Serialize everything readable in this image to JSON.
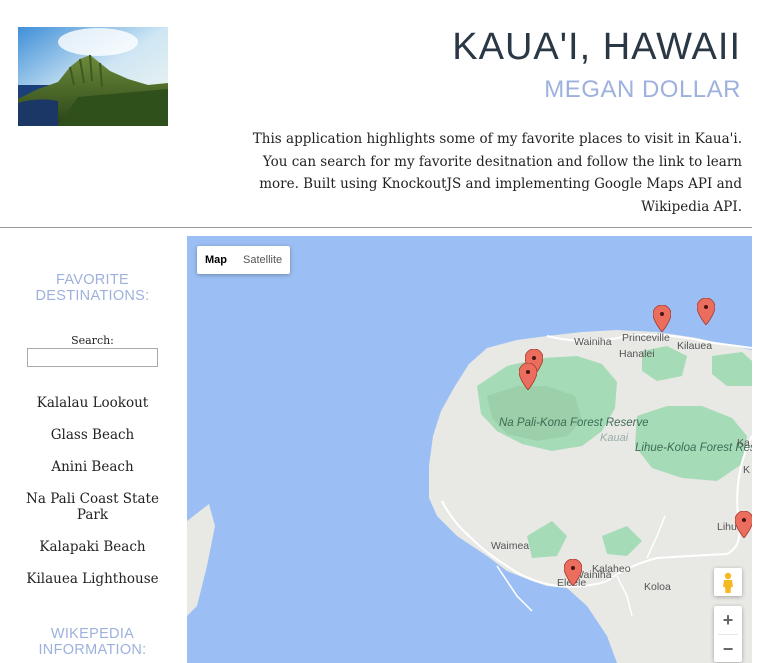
{
  "header": {
    "title": "KAUA'I, HAWAII",
    "subtitle": "MEGAN DOLLAR",
    "description": "This application highlights some of my favorite places to visit in Kaua'i. You can search for my favorite desitnation and follow the link to learn more. Built using KnockoutJS and implementing Google Maps API and Wikipedia API."
  },
  "sidebar": {
    "favorites_heading": "FAVORITE DESTINATIONS:",
    "search_label": "Search:",
    "search_value": "",
    "locations": [
      "Kalalau Lookout",
      "Glass Beach",
      "Anini Beach",
      "Na Pali Coast State Park",
      "Kalapaki Beach",
      "Kilauea Lighthouse"
    ],
    "wiki_heading": "WIKEPEDIA INFORMATION:"
  },
  "map": {
    "type_buttons": {
      "map": "Map",
      "satellite": "Satellite",
      "selected": "Map"
    },
    "zoom_in": "+",
    "zoom_out": "−",
    "labels": {
      "princeville": "Princeville",
      "hanalei": "Hanalei",
      "kilauea": "Kilauea",
      "wainiha": "Wainiha",
      "napali": "Na Pali-Kona Forest Reserve",
      "kauai": "Kauai",
      "lihue_koloa": "Lihue-Koloa Forest Reserve",
      "waimea": "Waimea",
      "kalaheo": "Kalaheo",
      "koloa": "Koloa",
      "eleele": "Eleele",
      "lihue_partial": "Lihu",
      "ka_partial": "Ka",
      "k_partial": "K"
    },
    "colors": {
      "water": "#9bbff4",
      "land": "#e8e8e4",
      "park": "#a6dbb8",
      "marker": "#ea6d5d"
    }
  }
}
